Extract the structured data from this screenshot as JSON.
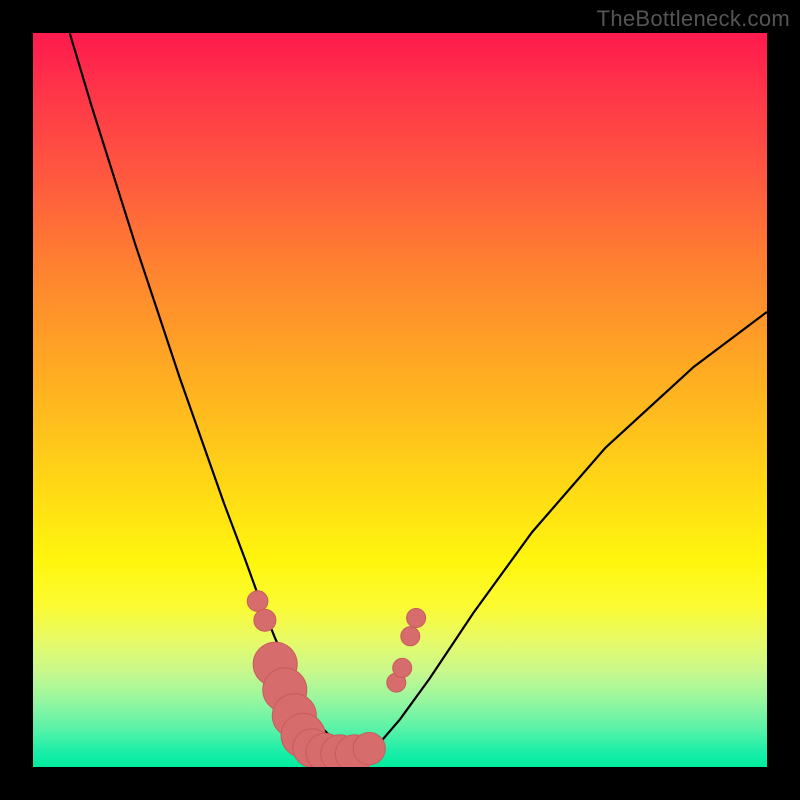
{
  "watermark": "TheBottleneck.com",
  "colors": {
    "curve_stroke": "#000000",
    "marker_fill": "#d76c6c",
    "marker_stroke": "#c95b5b",
    "bg_black": "#000000"
  },
  "chart_data": {
    "type": "line",
    "title": "",
    "xlabel": "",
    "ylabel": "",
    "xlim": [
      0,
      100
    ],
    "ylim": [
      0,
      100
    ],
    "grid": false,
    "legend": false,
    "series": [
      {
        "name": "bottleneck-curve",
        "x": [
          5,
          8,
          11,
          14,
          17,
          20,
          23,
          26,
          29,
          31,
          33,
          35,
          36.5,
          38,
          39.5,
          41,
          42.5,
          44,
          47,
          50,
          54,
          60,
          68,
          78,
          90,
          100
        ],
        "y": [
          100,
          90,
          80.5,
          71,
          62,
          53,
          44.5,
          36,
          28,
          22.5,
          17.5,
          13,
          10,
          7.3,
          5.2,
          3.7,
          2.6,
          2.0,
          3.0,
          6.5,
          12,
          21,
          32,
          43.5,
          54.5,
          62
        ]
      }
    ],
    "markers": [
      {
        "x": 30.6,
        "y": 22.6,
        "r": 1.4
      },
      {
        "x": 31.6,
        "y": 20.0,
        "r": 1.5
      },
      {
        "x": 33.0,
        "y": 14.0,
        "r": 3.0
      },
      {
        "x": 34.3,
        "y": 10.5,
        "r": 3.0
      },
      {
        "x": 35.6,
        "y": 7.0,
        "r": 3.0
      },
      {
        "x": 36.8,
        "y": 4.3,
        "r": 3.0
      },
      {
        "x": 38.0,
        "y": 2.6,
        "r": 2.6
      },
      {
        "x": 39.8,
        "y": 2.0,
        "r": 2.6
      },
      {
        "x": 41.8,
        "y": 1.8,
        "r": 2.6
      },
      {
        "x": 43.8,
        "y": 1.8,
        "r": 2.6
      },
      {
        "x": 45.8,
        "y": 2.5,
        "r": 2.2
      },
      {
        "x": 49.5,
        "y": 11.5,
        "r": 1.3
      },
      {
        "x": 50.3,
        "y": 13.5,
        "r": 1.3
      },
      {
        "x": 51.4,
        "y": 17.8,
        "r": 1.3
      },
      {
        "x": 52.2,
        "y": 20.3,
        "r": 1.3
      }
    ],
    "annotations": []
  }
}
